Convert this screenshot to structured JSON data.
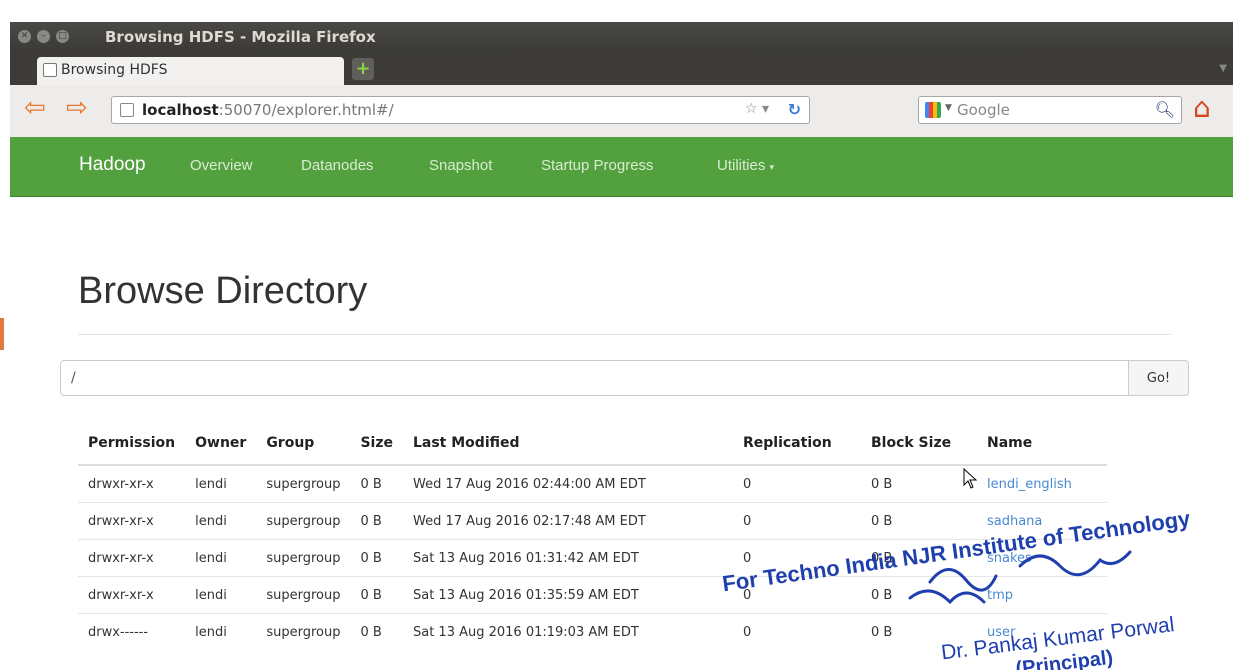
{
  "window": {
    "title": "Browsing HDFS - Mozilla Firefox"
  },
  "tab": {
    "title": "Browsing HDFS"
  },
  "url": {
    "host": "localhost",
    "path": ":50070/explorer.html#/"
  },
  "search": {
    "placeholder": "Google"
  },
  "nav": {
    "brand": "Hadoop",
    "items": [
      "Overview",
      "Datanodes",
      "Snapshot",
      "Startup Progress",
      "Utilities"
    ]
  },
  "page": {
    "title": "Browse Directory"
  },
  "path_input": {
    "value": "/"
  },
  "go_label": "Go!",
  "table": {
    "headers": [
      "Permission",
      "Owner",
      "Group",
      "Size",
      "Last Modified",
      "Replication",
      "Block Size",
      "Name"
    ],
    "rows": [
      [
        "drwxr-xr-x",
        "lendi",
        "supergroup",
        "0 B",
        "Wed 17 Aug 2016 02:44:00 AM EDT",
        "0",
        "0 B",
        "lendi_english"
      ],
      [
        "drwxr-xr-x",
        "lendi",
        "supergroup",
        "0 B",
        "Wed 17 Aug 2016 02:17:48 AM EDT",
        "0",
        "0 B",
        "sadhana"
      ],
      [
        "drwxr-xr-x",
        "lendi",
        "supergroup",
        "0 B",
        "Sat 13 Aug 2016 01:31:42 AM EDT",
        "0",
        "0 B",
        "snakes"
      ],
      [
        "drwxr-xr-x",
        "lendi",
        "supergroup",
        "0 B",
        "Sat 13 Aug 2016 01:35:59 AM EDT",
        "0",
        "0 B",
        "tmp"
      ],
      [
        "drwx------",
        "lendi",
        "supergroup",
        "0 B",
        "Sat 13 Aug 2016 01:19:03 AM EDT",
        "0",
        "0 B",
        "user"
      ]
    ]
  },
  "stamp": {
    "line1": "For Techno India NJR Institute of Technology",
    "line2": "Dr. Pankaj Kumar Porwal",
    "line3": "(Principal)"
  },
  "colors": {
    "nav_green": "#52a03e",
    "link_blue": "#4a8ad0",
    "stamp_blue": "#1f3fae"
  }
}
